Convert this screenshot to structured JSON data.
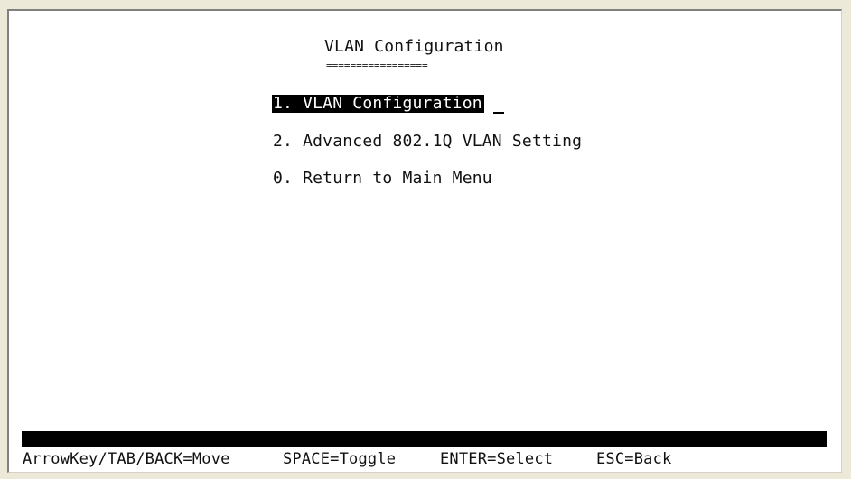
{
  "screen": {
    "title": "VLAN Configuration",
    "title_underline": "================="
  },
  "menu": {
    "items": [
      {
        "label": "1. VLAN Configuration",
        "selected": true
      },
      {
        "label": "2. Advanced 802.1Q VLAN Setting",
        "selected": false
      },
      {
        "label": "0. Return to Main Menu",
        "selected": false
      }
    ]
  },
  "footer": {
    "hints": [
      "ArrowKey/TAB/BACK=Move",
      "SPACE=Toggle",
      "ENTER=Select",
      "ESC=Back"
    ]
  },
  "colors": {
    "background": "#ffffff",
    "text": "#111111",
    "highlight_bg": "#000000",
    "highlight_fg": "#ffffff",
    "window_chrome": "#ece9d8"
  }
}
